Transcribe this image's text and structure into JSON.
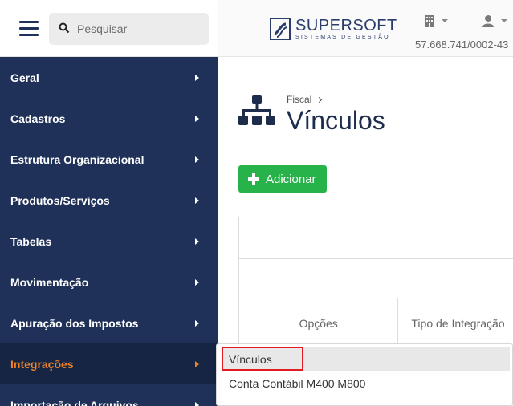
{
  "search": {
    "placeholder": "Pesquisar"
  },
  "sidebar": {
    "items": [
      {
        "label": "Geral"
      },
      {
        "label": "Cadastros"
      },
      {
        "label": "Estrutura Organizacional"
      },
      {
        "label": "Produtos/Serviços"
      },
      {
        "label": "Tabelas"
      },
      {
        "label": "Movimentação"
      },
      {
        "label": "Apuração dos Impostos"
      },
      {
        "label": "Integrações",
        "active": true
      },
      {
        "label": "Importação de Arquivos"
      }
    ]
  },
  "header": {
    "logo_title": "SUPERSOFT",
    "logo_subtitle": "SISTEMAS DE GESTÃO",
    "cnpj": "57.668.741/0002-43"
  },
  "main": {
    "breadcrumb": "Fiscal",
    "title": "Vínculos",
    "add_label": "Adicionar",
    "table_headers": [
      "Opções",
      "Tipo de Integração"
    ]
  },
  "dropdown": {
    "items": [
      "Vínculos",
      "Conta Contábil M400 M800"
    ]
  },
  "colors": {
    "sidebar_bg": "#1f3158",
    "active_text": "#e8832a",
    "add_button": "#27b34a",
    "highlight_border": "#e31b23"
  },
  "icons": {
    "menu": "hamburger-icon",
    "search": "search-icon",
    "company": "building-icon",
    "user": "user-icon",
    "page": "sitemap-icon",
    "add": "plus-icon"
  }
}
